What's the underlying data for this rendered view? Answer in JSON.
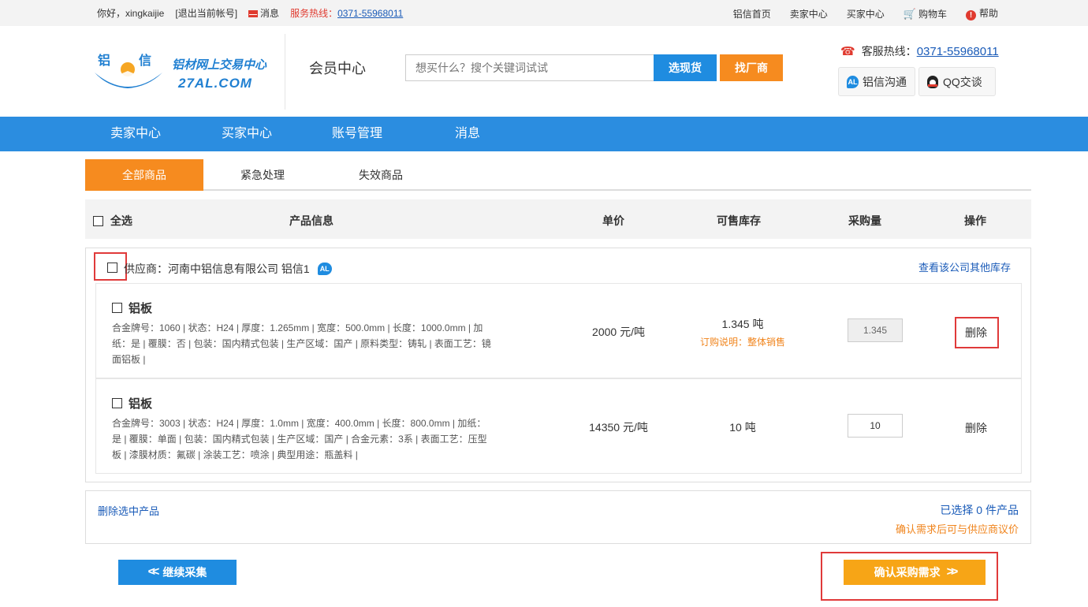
{
  "topbar": {
    "greeting": "你好，xingkaijie",
    "logout": "[退出当前帐号]",
    "messages": "消息",
    "hotline_label": "服务热线：",
    "hotline_number": "0371-55968011",
    "links": [
      "铝信首页",
      "卖家中心",
      "买家中心"
    ],
    "cart": "购物车",
    "help": "帮助"
  },
  "header": {
    "logo_chars": "铝 信",
    "logo_brand": "铝材网上交易中心",
    "logo_domain": "27AL.COM",
    "member_center": "会员中心",
    "search_placeholder": "想买什么？搜个关键词试试",
    "btn_select_goods": "选现货",
    "btn_find_factory": "找厂商",
    "service_label": "客服热线：",
    "service_number": "0371-55968011",
    "chat_al": "铝信沟通",
    "chat_qq": "QQ交谈",
    "al_badge": "AL"
  },
  "nav": [
    "卖家中心",
    "买家中心",
    "账号管理",
    "消息"
  ],
  "tabs": [
    "全部商品",
    "紧急处理",
    "失效商品"
  ],
  "table_header": {
    "select_all": "全选",
    "product_info": "产品信息",
    "unit_price": "单价",
    "stock": "可售库存",
    "quantity": "采购量",
    "action": "操作"
  },
  "supplier": {
    "name": "供应商：河南中铝信息有限公司 铝信1",
    "badge": "AL",
    "more_stock": "查看该公司其他库存"
  },
  "products": [
    {
      "name": "铝板",
      "attr_lines": [
        "合金牌号：1060 | 状态：H24 | 厚度：1.265mm | 宽度：500.0mm | 长度：1000.0mm | 加",
        "纸：是 | 覆膜：否 | 包装：国内精式包装 | 生产区域：国产 | 原料类型：铸轧 | 表面工艺：镜",
        "面铝板 |"
      ],
      "price": "2000 元/吨",
      "stock": "1.345 吨",
      "note": "订购说明：整体销售",
      "quantity": "1.345",
      "delete": "删除"
    },
    {
      "name": "铝板",
      "attr_lines": [
        "合金牌号：3003 | 状态：H24 | 厚度：1.0mm | 宽度：400.0mm | 长度：800.0mm | 加纸：",
        "是 | 覆膜：单面 | 包装：国内精式包装 | 生产区域：国产 | 合金元素：3系 | 表面工艺：压型",
        "板 | 漆膜材质：氟碳 | 涂装工艺：喷涂 | 典型用途：瓶盖料 |"
      ],
      "price": "14350 元/吨",
      "stock": "10 吨",
      "quantity": "10",
      "delete": "删除"
    }
  ],
  "footer": {
    "delete_selected": "删除选中产品",
    "selected_count": "已选择 0 件产品",
    "tip": "确认需求后可与供应商议价",
    "continue": "继续采集",
    "confirm": "确认采购需求"
  },
  "colors": {
    "primary_blue": "#2b8de0",
    "accent_orange": "#f68b1f",
    "confirm_orange": "#f7a516",
    "highlight_red": "#e03a3a"
  }
}
